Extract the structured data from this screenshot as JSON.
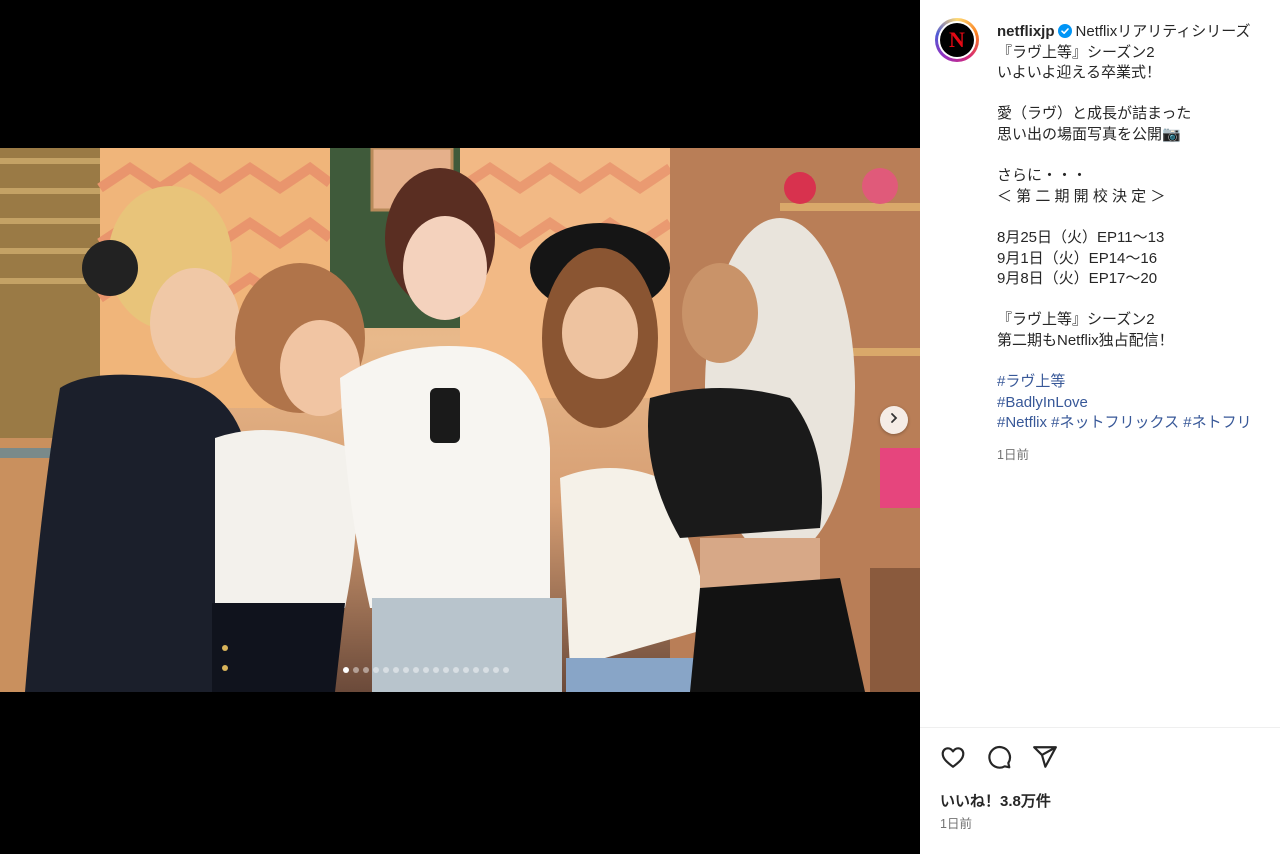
{
  "post": {
    "username": "netflixjp",
    "avatar_letter": "N",
    "caption_lines": [
      {
        "text": "Netflixリアリティシリーズ",
        "kind": "first"
      },
      {
        "text": "『ラヴ上等』シーズン2",
        "kind": "text"
      },
      {
        "text": "いよいよ迎える卒業式！",
        "kind": "text"
      },
      {
        "text": "",
        "kind": "blank"
      },
      {
        "text": "愛（ラヴ）と成長が詰まった",
        "kind": "text"
      },
      {
        "text": "思い出の場面写真を公開📷",
        "kind": "text"
      },
      {
        "text": "",
        "kind": "blank"
      },
      {
        "text": "さらに・・・",
        "kind": "text"
      },
      {
        "text": "＜ 第 二 期 開 校 決 定 ＞",
        "kind": "text"
      },
      {
        "text": "",
        "kind": "blank"
      },
      {
        "text": "8月25日（火）EP11〜13",
        "kind": "text"
      },
      {
        "text": "9月1日（火）EP14〜16",
        "kind": "text"
      },
      {
        "text": "9月8日（火）EP17〜20",
        "kind": "text"
      },
      {
        "text": "",
        "kind": "blank"
      },
      {
        "text": "『ラヴ上等』シーズン2",
        "kind": "text"
      },
      {
        "text": "第二期もNetflix独占配信！",
        "kind": "text"
      },
      {
        "text": "",
        "kind": "blank"
      },
      {
        "text": "#ラヴ上等",
        "kind": "tag"
      },
      {
        "text": "#BadlyInLove",
        "kind": "tag"
      },
      {
        "text": "#Netflix #ネットフリックス #ネトフリ",
        "kind": "tag"
      }
    ],
    "caption_time": "1日前",
    "likes": "いいね！3.8万件",
    "post_time": "1日前"
  },
  "carousel": {
    "total": 17,
    "current": 1
  },
  "icons": {
    "like": "heart-icon",
    "comment": "comment-icon",
    "share": "share-icon",
    "verified": "verified-badge-icon",
    "next": "chevron-right-icon"
  },
  "colors": {
    "hashtag": "#385898",
    "verified": "#0095f6",
    "netflix_red": "#e50914"
  }
}
